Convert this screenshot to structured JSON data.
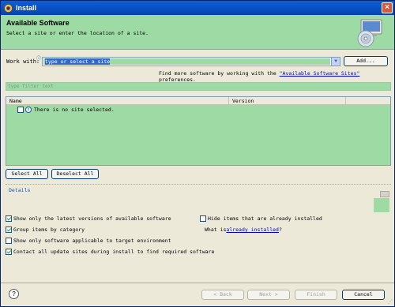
{
  "window": {
    "title": "Install",
    "close_glyph": "×"
  },
  "banner": {
    "title": "Available Software",
    "subtitle": "Select a site or enter the location of a site.",
    "icon": "install-cd-icon"
  },
  "work_with": {
    "label": "Work with:",
    "value": "type or select a site",
    "add_label": "Add..."
  },
  "find_more": {
    "prefix": "Find more software by working with the ",
    "link": "\"Available Software Sites\"",
    "suffix": " preferences."
  },
  "filter": {
    "placeholder": "type filter text"
  },
  "table": {
    "columns": [
      "Name",
      "Version"
    ],
    "rows": [
      {
        "checked": false,
        "icon": "info-icon",
        "text": "There is no site selected."
      }
    ]
  },
  "selection_buttons": {
    "select_all": "Select All",
    "deselect_all": "Deselect All"
  },
  "details": {
    "label": "Details"
  },
  "options": {
    "latest_versions": {
      "label": "Show only the latest versions of available software",
      "checked": true
    },
    "hide_installed": {
      "label": "Hide items that are already installed",
      "checked": false
    },
    "group_by_category": {
      "label": "Group items by category",
      "checked": true
    },
    "what_is_prefix": "What is ",
    "what_is_link": "already installed",
    "what_is_suffix": "?",
    "target_env": {
      "label": "Show only software applicable to target environment",
      "checked": false
    },
    "contact_sites": {
      "label": "Contact all update sites during install to find required software",
      "checked": true
    }
  },
  "footer": {
    "back": "< Back",
    "next": "Next >",
    "finish": "Finish",
    "cancel": "Cancel",
    "help_glyph": "?"
  },
  "colors": {
    "highlight_green": "#9edaa4",
    "title_blue": "#0a5fd8",
    "link_blue": "#0000cc",
    "selection_blue": "#316ac5"
  }
}
